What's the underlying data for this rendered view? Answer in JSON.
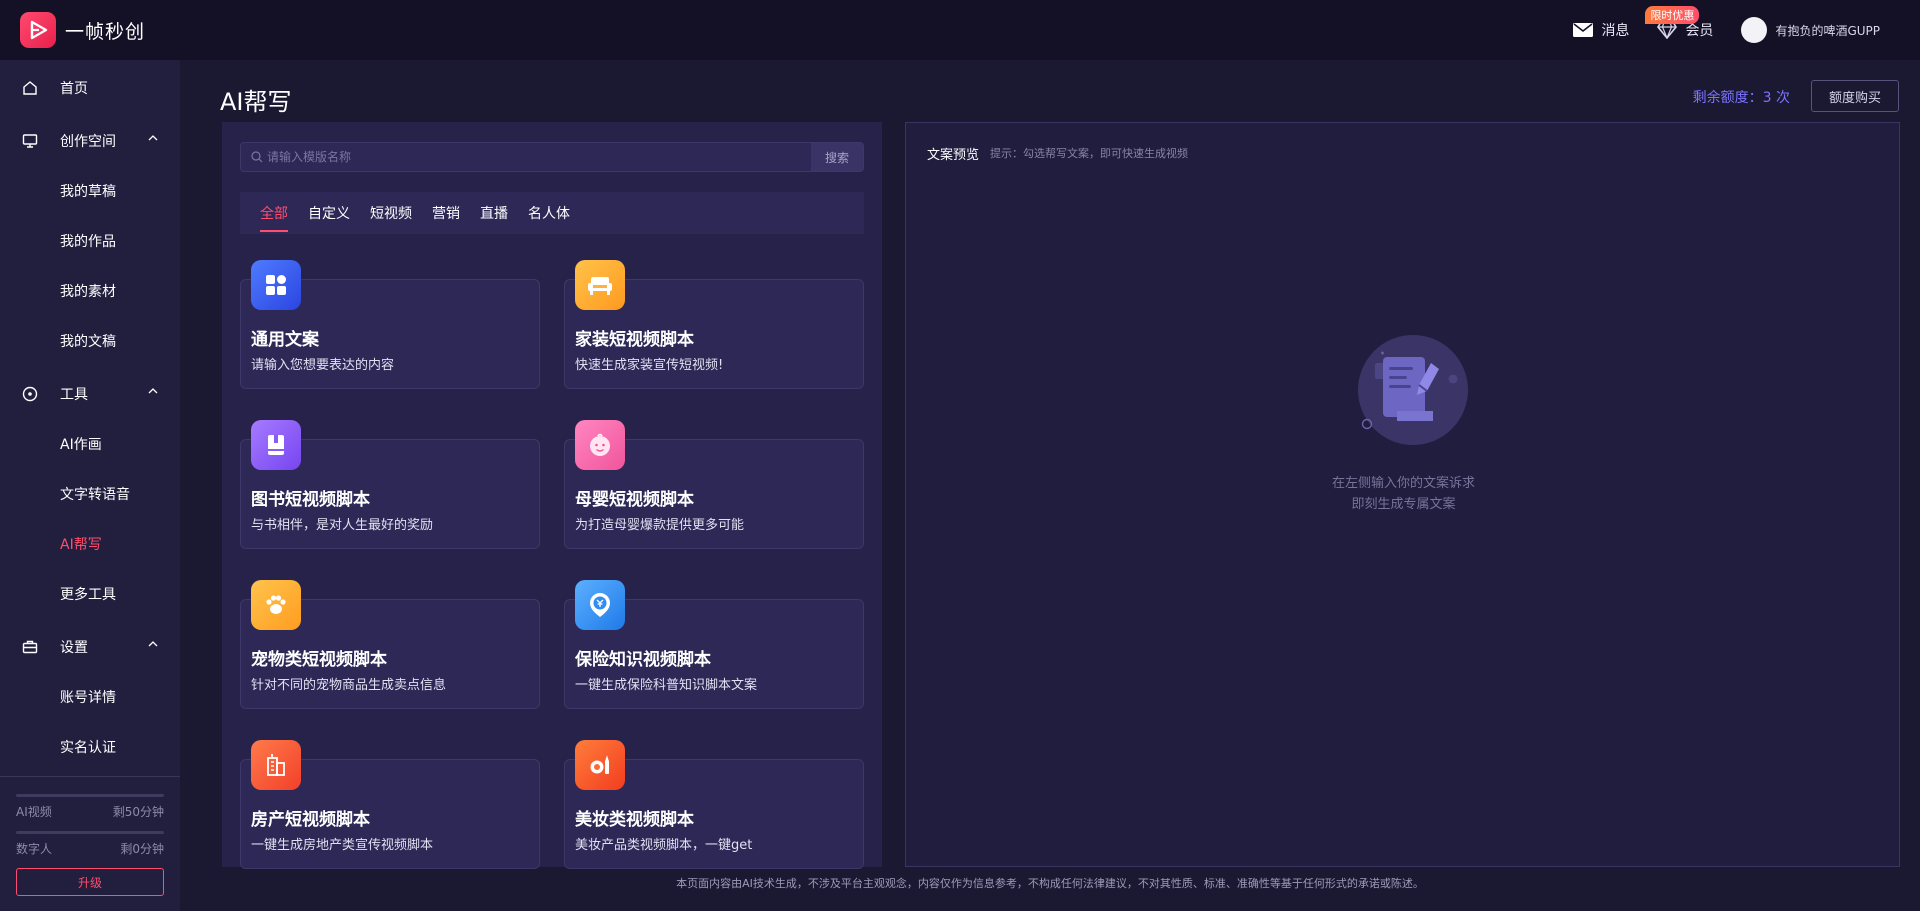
{
  "app": {
    "name": "一帧秒创"
  },
  "topbar": {
    "messages_label": "消息",
    "member_label": "会员",
    "promo_badge": "限时优惠",
    "username": "有抱负的啤酒GUPP"
  },
  "sidebar": {
    "home": "首页",
    "creation_space": {
      "label": "创作空间",
      "items": [
        "我的草稿",
        "我的作品",
        "我的素材",
        "我的文稿"
      ]
    },
    "tools": {
      "label": "工具",
      "items": [
        "AI作画",
        "文字转语音",
        "AI帮写",
        "更多工具"
      ],
      "active_index": 2
    },
    "settings": {
      "label": "设置",
      "items": [
        "账号详情",
        "实名认证"
      ]
    },
    "quota": [
      {
        "label": "AI视频",
        "value": "剩50分钟",
        "fraction": 0
      },
      {
        "label": "数字人",
        "value": "剩0分钟",
        "fraction": 0
      }
    ],
    "upgrade_label": "升级"
  },
  "main": {
    "title": "AI帮写",
    "remaining_label": "剩余额度：3 次",
    "buy_label": "额度购买",
    "search": {
      "placeholder": "请输入模版名称",
      "button": "搜索"
    },
    "tabs": [
      "全部",
      "自定义",
      "短视频",
      "营销",
      "直播",
      "名人体"
    ],
    "active_tab": 0,
    "cards": [
      {
        "title": "通用文案",
        "desc": "请输入您想要表达的内容",
        "icon": "grid-icon",
        "color": "#3b63f5"
      },
      {
        "title": "家装短视频脚本",
        "desc": "快速生成家装宣传短视频!",
        "icon": "sofa-icon",
        "color": "#ffaa2c"
      },
      {
        "title": "图书短视频脚本",
        "desc": "与书相伴，是对人生最好的奖励",
        "icon": "book-icon",
        "color": "#8b5cf6"
      },
      {
        "title": "母婴短视频脚本",
        "desc": "为打造母婴爆款提供更多可能",
        "icon": "baby-icon",
        "color": "#f062a4"
      },
      {
        "title": "宠物类短视频脚本",
        "desc": "针对不同的宠物商品生成卖点信息",
        "icon": "paw-icon",
        "color": "#ffab2e"
      },
      {
        "title": "保险知识视频脚本",
        "desc": "一键生成保险科普知识脚本文案",
        "icon": "insurance-icon",
        "color": "#2f8cf5"
      },
      {
        "title": "房产短视频脚本",
        "desc": "一键生成房地产类宣传视频脚本",
        "icon": "building-icon",
        "color": "#ff5a3c"
      },
      {
        "title": "美妆类视频脚本",
        "desc": "美妆产品类视频脚本，一键get",
        "icon": "cosmetics-icon",
        "color": "#ff5a2c"
      }
    ],
    "preview": {
      "label": "文案预览",
      "hint": "提示：勾选帮写文案，即可快速生成视频",
      "empty_line1": "在左侧输入你的文案诉求",
      "empty_line2": "即刻生成专属文案"
    }
  },
  "footer": {
    "disclaimer": "本页面内容由AI技术生成，不涉及平台主观观念，内容仅作为信息参考，不构成任何法律建议，不对其性质、标准、准确性等基于任何形式的承诺或陈述。"
  }
}
